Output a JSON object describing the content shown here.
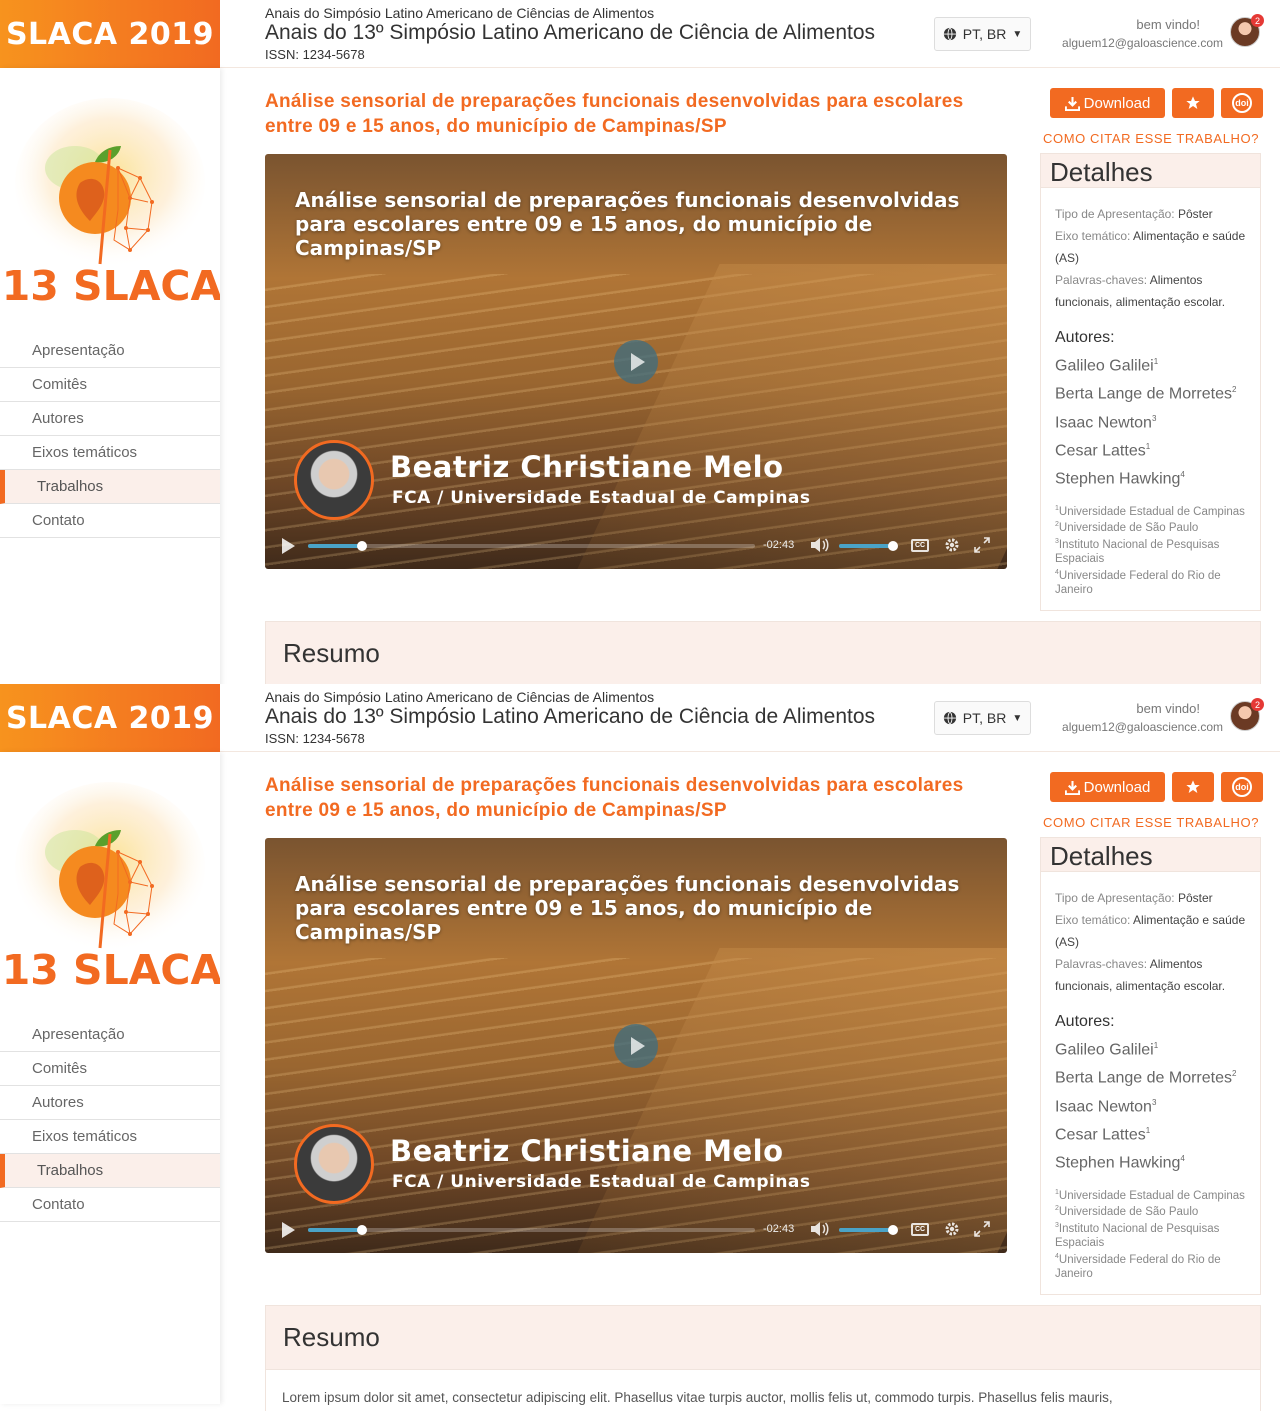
{
  "header": {
    "brand": "SLACA 2019",
    "subtitle": "Anais do Simpósio Latino Americano de Ciências de Alimentos",
    "event_title": "Anais do 13º Simpósio Latino Americano de Ciência de Alimentos",
    "issn": "ISSN: 1234-5678",
    "language": "PT, BR",
    "welcome": "bem vindo!",
    "email": "alguem12@galoascience.com",
    "notifications": "2"
  },
  "sidebar": {
    "logo_text": "13 SLACA",
    "items": [
      {
        "label": "Apresentação"
      },
      {
        "label": "Comitês"
      },
      {
        "label": "Autores"
      },
      {
        "label": "Eixos temáticos"
      },
      {
        "label": "Trabalhos",
        "active": true
      },
      {
        "label": "Contato"
      }
    ]
  },
  "paper": {
    "title": "Análise sensorial de preparações funcionais desenvolvidas para escolares entre 09 e 15 anos, do município de Campinas/SP",
    "download_label": "Download",
    "doi_label": "doi",
    "cite_label": "COMO CITAR ESSE TRABALHO?"
  },
  "video": {
    "title": "Análise sensorial de preparações funcionais desenvolvidas para escolares entre 09 e 15 anos, do município de Campinas/SP",
    "speaker": "Beatriz Christiane Melo",
    "affiliation": "FCA / Universidade Estadual de Campinas",
    "time_remaining": "-02:43",
    "progress_fraction": 0.12,
    "volume_fraction": 0.95,
    "cc_label": "CC"
  },
  "details": {
    "heading": "Detalhes",
    "type_label": "Tipo de Apresentação:",
    "type_value": "Pôster",
    "axis_label": "Eixo temático:",
    "axis_value": "Alimentação e saúde (AS)",
    "keywords_label": "Palavras-chaves:",
    "keywords_value": "Alimentos funcionais, alimentação escolar.",
    "authors_label": "Autores:",
    "authors": [
      {
        "name": "Galileo Galilei",
        "sup": "1"
      },
      {
        "name": "Berta Lange de Morretes",
        "sup": "2"
      },
      {
        "name": "Isaac Newton",
        "sup": "3"
      },
      {
        "name": "Cesar Lattes",
        "sup": "1"
      },
      {
        "name": "Stephen Hawking",
        "sup": "4"
      }
    ],
    "affiliations": [
      {
        "sup": "1",
        "name": "Universidade Estadual de Campinas"
      },
      {
        "sup": "2",
        "name": "Universidade de São Paulo"
      },
      {
        "sup": "3",
        "name": "Instituto Nacional de Pesquisas Espaciais"
      },
      {
        "sup": "4",
        "name": "Universidade Federal do Rio de Janeiro"
      }
    ]
  },
  "abstract": {
    "heading": "Resumo",
    "text": "Lorem ipsum dolor sit amet, consectetur adipiscing elit. Phasellus vitae turpis auctor, mollis felis ut, commodo turpis. Phasellus felis mauris,"
  },
  "colors": {
    "accent": "#f26a21",
    "accent_light": "#fbefea",
    "video_progress": "#4aa3c7"
  }
}
